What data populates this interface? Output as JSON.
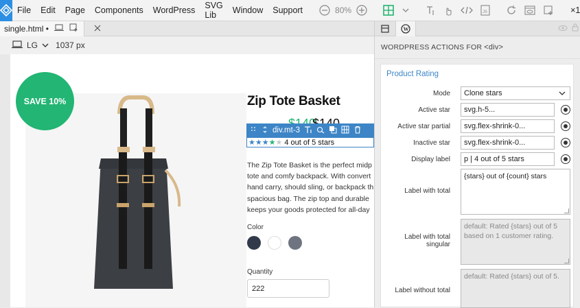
{
  "menu": [
    "File",
    "Edit",
    "Page",
    "Components",
    "WordPress",
    "SVG Lib",
    "Window",
    "Support"
  ],
  "toolbar": {
    "zoom": "80%",
    "multiplier": "×1"
  },
  "tab": {
    "filename": "single.html",
    "modified": "•"
  },
  "device": {
    "size": "LG",
    "width": "1037 px"
  },
  "product": {
    "badge": "SAVE 10%",
    "title": "Zip Tote Basket",
    "price_sale": "$140",
    "price": "$140",
    "rating_label": "4 out of 5 stars",
    "stars_active": 4,
    "stars_total": 5,
    "description": [
      "The Zip Tote Basket is the perfect midp",
      "tote and comfy backpack. With convert",
      "hand carry, should sling, or backpack th",
      "spacious bag. The zip top and durable",
      "keeps your goods protected for all-day"
    ],
    "color_label": "Color",
    "colors": [
      "#303a4b",
      "#ffffff",
      "#6e7480"
    ],
    "quantity_label": "Quantity",
    "quantity": "222"
  },
  "selection": {
    "element": "div.mt-3"
  },
  "panel": {
    "header": "WORDPRESS ACTIONS FOR",
    "header_tag": "<div>",
    "section_title": "Product Rating",
    "fields": {
      "mode_label": "Mode",
      "mode_value": "Clone stars",
      "active_star_label": "Active star",
      "active_star_value": "svg.h-5...",
      "active_partial_label": "Active star partial",
      "active_partial_value": "svg.flex-shrink-0...",
      "inactive_star_label": "Inactive star",
      "inactive_star_value": "svg.flex-shrink-0...",
      "display_label_label": "Display label",
      "display_label_value": "p | 4 out of 5 stars",
      "label_with_total_label": "Label with total",
      "label_with_total_value": "{stars} out of {count} stars",
      "label_singular_label": "Label with total singular",
      "label_singular_placeholder": "default: Rated {stars} out of 5 based on 1 customer rating.",
      "label_without_total_label": "Label without total",
      "label_without_total_placeholder": "default: Rated {stars} out of 5."
    }
  },
  "colors": {
    "accent": "#3d85c6",
    "badge": "#22b573",
    "star_active": "#3d85c6",
    "star_partial": "#22b573",
    "star_inactive": "#c8c8c8"
  }
}
